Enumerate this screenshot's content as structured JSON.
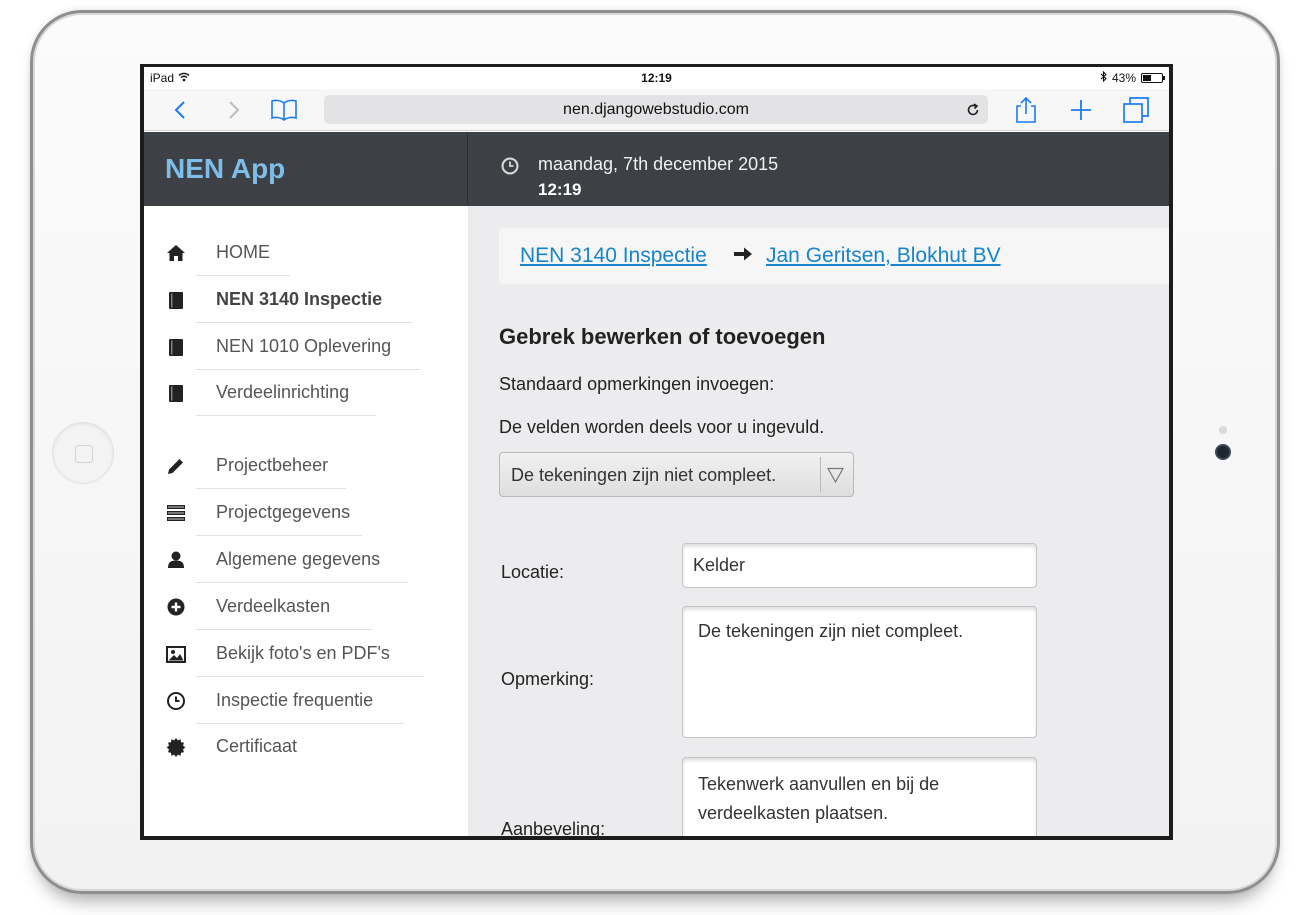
{
  "status_bar": {
    "device": "iPad",
    "time": "12:19",
    "battery": "43%",
    "battery_level": 0.43
  },
  "browser": {
    "url": "nen.djangowebstudio.com",
    "icons": [
      "chevron-left-icon",
      "chevron-right-icon",
      "bookmarks-icon",
      "reload-icon",
      "share-icon",
      "plus-icon",
      "tabs-icon"
    ],
    "accent_color": "#1a7cf5"
  },
  "header": {
    "brand": "NEN App",
    "date": "maandag, 7th december 2015",
    "time": "12:19",
    "brand_color": "#7dbde8",
    "background": "#3d4145"
  },
  "sidebar": {
    "items": [
      {
        "label": "HOME",
        "icon": "home-icon"
      },
      {
        "label": "NEN 3140 Inspectie",
        "icon": "book-icon",
        "active": true
      },
      {
        "label": "NEN 1010 Oplevering",
        "icon": "book-icon"
      },
      {
        "label": "Verdeelinrichting",
        "icon": "book-icon"
      },
      {
        "label": "Projectbeheer",
        "icon": "pencil-icon"
      },
      {
        "label": "Projectgegevens",
        "icon": "list-icon"
      },
      {
        "label": "Algemene gegevens",
        "icon": "user-icon"
      },
      {
        "label": "Verdeelkasten",
        "icon": "plus-circle-icon"
      },
      {
        "label": "Bekijk foto's en PDF's",
        "icon": "image-icon"
      },
      {
        "label": "Inspectie frequentie",
        "icon": "clock-icon"
      },
      {
        "label": "Certificaat",
        "icon": "certificate-icon"
      }
    ]
  },
  "main": {
    "breadcrumb": {
      "first": "NEN 3140 Inspectie",
      "second": "Jan Geritsen, Blokhut BV",
      "link_color": "#1784cc"
    },
    "heading": "Gebrek bewerken of toevoegen",
    "intro": "Standaard opmerkingen invoegen:",
    "hint": "De velden worden deels voor u ingevuld.",
    "select_value": "De tekeningen zijn niet compleet.",
    "form": {
      "locatie_label": "Locatie:",
      "locatie_value": "Kelder",
      "opmerking_label": "Opmerking:",
      "opmerking_value": "De tekeningen zijn niet compleet.",
      "aanbeveling_label": "Aanbeveling:",
      "aanbeveling_value": "Tekenwerk aanvullen en bij de verdeelkasten plaatsen."
    }
  }
}
